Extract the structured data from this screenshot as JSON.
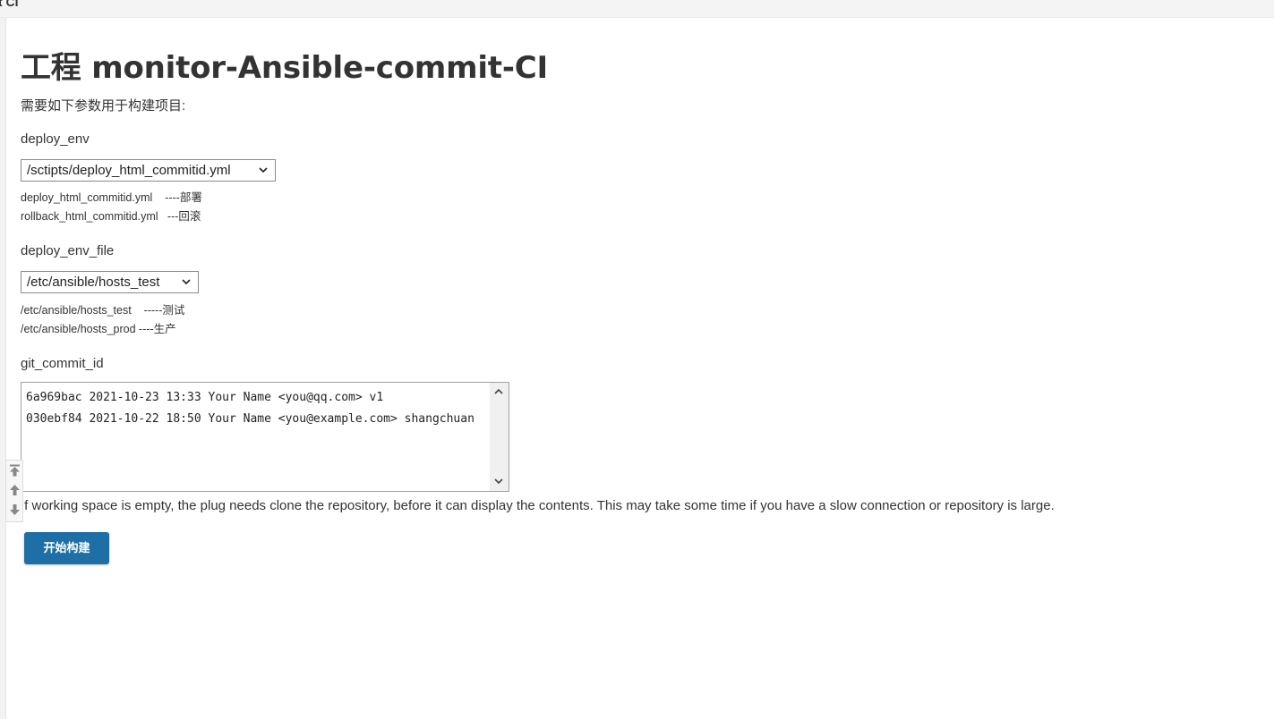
{
  "topbar": {
    "title_fragment": "t CI"
  },
  "page": {
    "title": "工程 monitor-Ansible-commit-CI",
    "description": "需要如下参数用于构建项目:"
  },
  "params": {
    "deploy_env": {
      "label": "deploy_env",
      "selected": "/sctipts/deploy_html_commitid.yml",
      "help": [
        "deploy_html_commitid.yml    ----部署",
        "rollback_html_commitid.yml   ---回滚"
      ]
    },
    "deploy_env_file": {
      "label": "deploy_env_file",
      "selected": "/etc/ansible/hosts_test",
      "help": [
        "/etc/ansible/hosts_test    -----测试",
        "/etc/ansible/hosts_prod ----生产"
      ]
    },
    "git_commit_id": {
      "label": "git_commit_id",
      "options": [
        "6a969bac 2021-10-23 13:33 Your Name <you@qq.com> v1",
        "030ebf84 2021-10-22 18:50 Your Name <you@example.com> shangchuan"
      ],
      "note": "If working space is empty, the plug needs clone the repository, before it can display the contents. This may take some time if you have a slow connection or repository is large."
    }
  },
  "actions": {
    "build_label": "开始构建"
  },
  "icons": {
    "select_arrow": "chevron-down-icon",
    "scroll_up": "chevron-up-icon",
    "scroll_down": "chevron-down-icon",
    "nav_top": "scroll-to-top-icon",
    "nav_up": "scroll-up-icon",
    "nav_down": "scroll-down-icon"
  },
  "colors": {
    "accent": "#1d6fa5",
    "text": "#333333"
  }
}
